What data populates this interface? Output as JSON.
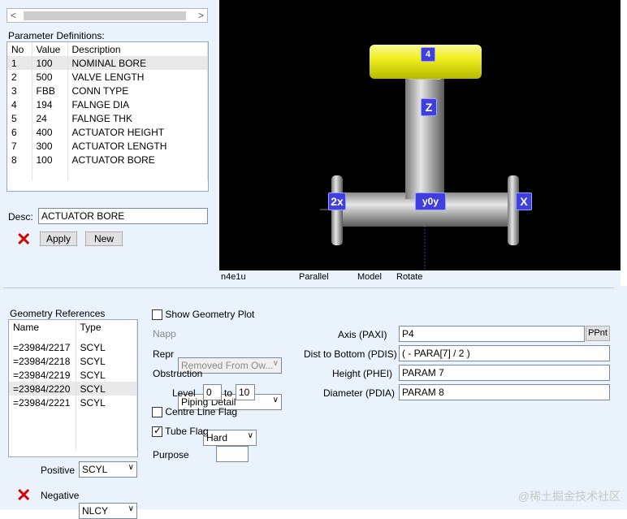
{
  "param_defs": {
    "title": "Parameter Definitions:",
    "columns": [
      "No",
      "Value",
      "Description"
    ],
    "rows": [
      {
        "no": "1",
        "value": "100",
        "desc": "NOMINAL BORE"
      },
      {
        "no": "2",
        "value": "500",
        "desc": "VALVE LENGTH"
      },
      {
        "no": "3",
        "value": "FBB",
        "desc": "CONN TYPE"
      },
      {
        "no": "4",
        "value": "194",
        "desc": "FALNGE DIA"
      },
      {
        "no": "5",
        "value": "24",
        "desc": "FALNGE THK"
      },
      {
        "no": "6",
        "value": "400",
        "desc": "ACTUATOR HEIGHT"
      },
      {
        "no": "7",
        "value": "300",
        "desc": "ACTUATOR LENGTH"
      },
      {
        "no": "8",
        "value": "100",
        "desc": "ACTUATOR BORE"
      }
    ],
    "desc_label": "Desc:",
    "desc_value": "ACTUATOR BORE",
    "apply_label": "Apply",
    "new_label": "New"
  },
  "viewport": {
    "markers": {
      "axis_z": "Z",
      "axis_x": "X",
      "left": "2x",
      "center": "y0y",
      "top": "4"
    },
    "status": {
      "name": "n4e1u",
      "projection": "Parallel",
      "mode": "Model",
      "action": "Rotate"
    }
  },
  "geometry_refs": {
    "title": "Geometry References",
    "columns": [
      "Name",
      "Type"
    ],
    "rows": [
      {
        "name": "=23984/2217",
        "type": "SCYL"
      },
      {
        "name": "=23984/2218",
        "type": "SCYL"
      },
      {
        "name": "=23984/2219",
        "type": "SCYL"
      },
      {
        "name": "=23984/2220",
        "type": "SCYL"
      },
      {
        "name": "=23984/2221",
        "type": "SCYL"
      }
    ],
    "positive_label": "Positive",
    "positive_value": "SCYL",
    "negative_label": "Negative",
    "negative_value": "NLCY"
  },
  "options": {
    "show_plot_label": "Show Geometry Plot",
    "napp_label": "Napp",
    "napp_value": "Removed From Ow...",
    "repr_label": "Repr",
    "repr_value": "Piping Detail",
    "obstruction_label": "Obstruction",
    "obstruction_value": "Hard",
    "level_label": "Level",
    "level_from": "0",
    "level_to_label": "to",
    "level_to": "10",
    "centre_line_label": "Centre Line Flag",
    "tube_flag_label": "Tube Flag",
    "tube_flag_checked": true,
    "purpose_label": "Purpose",
    "purpose_value": ""
  },
  "properties": {
    "axis_label": "Axis (PAXI)",
    "axis_value": "P4",
    "ppnt_label": "PPnt",
    "dist_label": "Dist to Bottom (PDIS)",
    "dist_value": "( - PARA[7] / 2 )",
    "height_label": "Height (PHEI)",
    "height_value": "PARAM 7",
    "diameter_label": "Diameter (PDIA)",
    "diameter_value": "PARAM 8"
  },
  "watermark": "@稀土掘金技术社区"
}
